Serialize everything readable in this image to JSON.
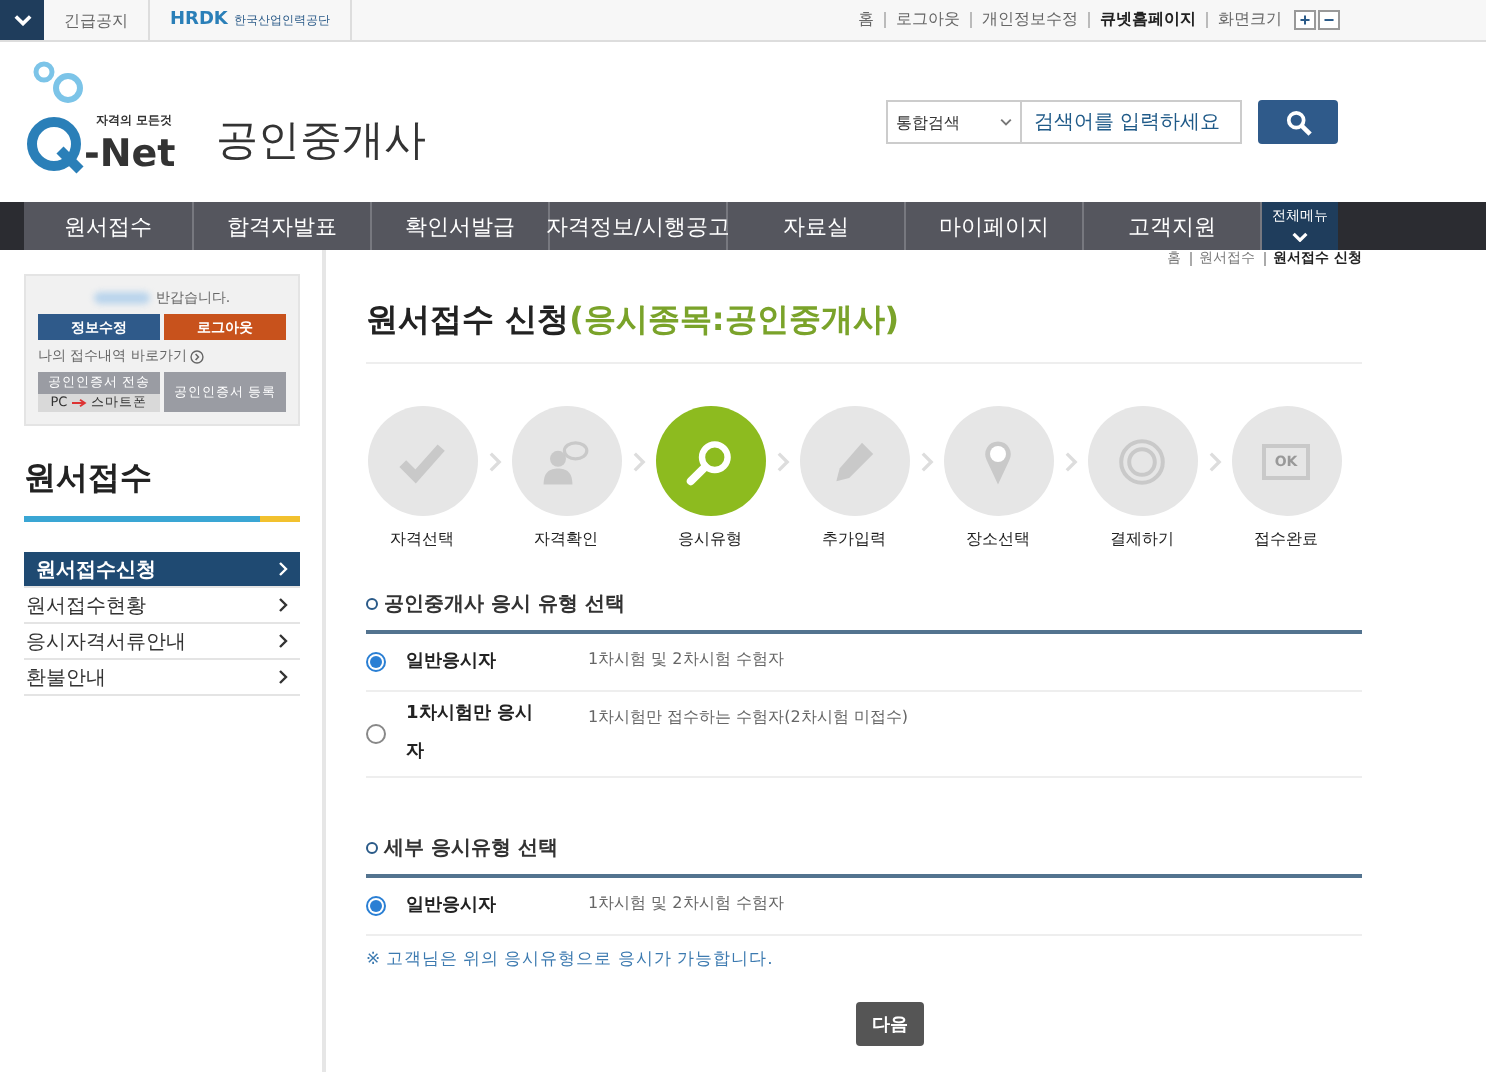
{
  "top_bar": {
    "left_links": [
      "긴급공지"
    ],
    "agency": {
      "mark": "HRDK",
      "name": "한국산업인력공단"
    },
    "right_links": [
      {
        "label": "홈",
        "emphasized": false
      },
      {
        "label": "로그아웃",
        "emphasized": false
      },
      {
        "label": "개인정보수정",
        "emphasized": false
      },
      {
        "label": "큐넷홈페이지",
        "emphasized": true
      },
      {
        "label": "화면크기",
        "emphasized": false
      }
    ],
    "zoom_buttons": [
      "+",
      "−"
    ]
  },
  "header": {
    "logo": {
      "tagline": "자격의 모든것",
      "name": "-Net"
    },
    "site_title": "공인중개사",
    "search": {
      "scope": "통합검색",
      "placeholder": "검색어를 입력하세요"
    }
  },
  "nav": {
    "items": [
      {
        "label": "원서접수"
      },
      {
        "label": "합격자발표"
      },
      {
        "label": "확인서발급"
      },
      {
        "label": "자격정보/시행공고"
      },
      {
        "label": "자료실"
      },
      {
        "label": "마이페이지"
      },
      {
        "label": "고객지원"
      }
    ],
    "all_menu": "전체메뉴"
  },
  "sidebar": {
    "user_box": {
      "greeting": "반갑습니다.",
      "buttons": [
        {
          "label": "정보수정",
          "kind": "primary"
        },
        {
          "label": "로그아웃",
          "kind": "danger"
        }
      ],
      "shortcut": "나의 접수내역 바로가기",
      "cert_buttons": [
        {
          "label": "공인인증서 전송",
          "from": "PC",
          "to": "스마트폰"
        },
        {
          "label": "공인인증서 등록"
        }
      ]
    },
    "title": "원서접수",
    "menu": [
      {
        "label": "원서접수신청",
        "selected": true
      },
      {
        "label": "원서접수현황",
        "selected": false
      },
      {
        "label": "응시자격서류안내",
        "selected": false
      },
      {
        "label": "환불안내",
        "selected": false
      }
    ]
  },
  "breadcrumb": [
    "홈",
    "원서접수",
    "원서접수 신청"
  ],
  "page_title": {
    "main": "원서접수 신청",
    "sub": "(응시종목:공인중개사)"
  },
  "steps": [
    {
      "label": "자격선택",
      "kind": "check",
      "selected": false
    },
    {
      "label": "자격확인",
      "kind": "person",
      "selected": false
    },
    {
      "label": "응시유형",
      "kind": "search",
      "selected": true
    },
    {
      "label": "추가입력",
      "kind": "pencil",
      "selected": false
    },
    {
      "label": "장소선택",
      "kind": "pin",
      "selected": false
    },
    {
      "label": "결제하기",
      "kind": "coin",
      "selected": false
    },
    {
      "label": "접수완료",
      "kind": "monitor",
      "screen_text": "OK",
      "selected": false
    }
  ],
  "sections": [
    {
      "title": "공인중개사 응시 유형 선택",
      "options": [
        {
          "label": "일반응시자",
          "description": "1차시험 및 2차시험 수험자",
          "selected": true
        },
        {
          "label": "1차시험만 응시자",
          "description": "1차시험만 접수하는 수험자(2차시험 미접수)",
          "selected": false
        }
      ]
    },
    {
      "title": "세부 응시유형 선택",
      "options": [
        {
          "label": "일반응시자",
          "description": "1차시험 및 2차시험 수험자",
          "selected": true
        }
      ]
    }
  ],
  "note": "※ 고객님은 위의 응시유형으로 응시가 가능합니다.",
  "next_button": "다음"
}
